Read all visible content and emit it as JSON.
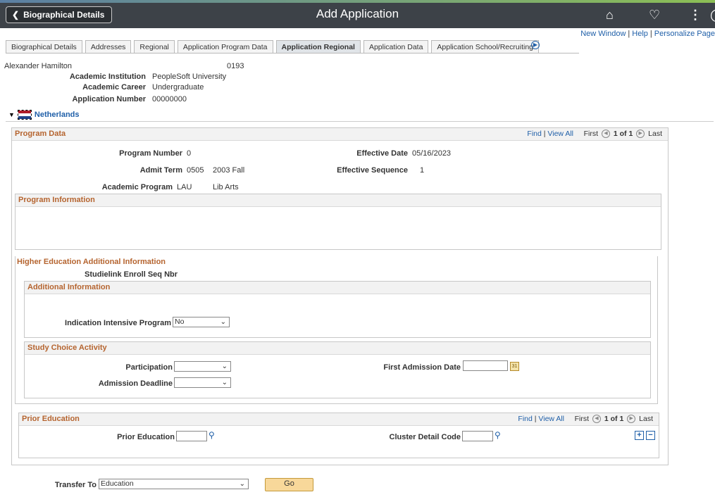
{
  "header": {
    "back_label": "Biographical Details",
    "title": "Add Application",
    "icons": [
      "home-icon",
      "bell-icon",
      "more-icon"
    ]
  },
  "links": {
    "new_window": "New Window",
    "help": "Help",
    "personalize": "Personalize Page"
  },
  "tabs": [
    {
      "label": "Biographical Details",
      "active": false
    },
    {
      "label": "Addresses",
      "active": false
    },
    {
      "label": "Regional",
      "active": false
    },
    {
      "label": "Application Program Data",
      "active": false
    },
    {
      "label": "Application Regional",
      "active": true
    },
    {
      "label": "Application Data",
      "active": false
    },
    {
      "label": "Application School/Recruiting",
      "active": false
    }
  ],
  "person": {
    "name": "Alexander Hamilton",
    "id": "0193",
    "institution_label": "Academic Institution",
    "institution": "PeopleSoft University",
    "career_label": "Academic Career",
    "career": "Undergraduate",
    "appnum_label": "Application Number",
    "appnum": "00000000"
  },
  "country": {
    "name": "Netherlands",
    "flag_colors": [
      "#ae1c28",
      "#ffffff",
      "#21468b"
    ]
  },
  "program_data": {
    "title": "Program Data",
    "nav": {
      "find": "Find",
      "view_all": "View All",
      "first": "First",
      "count": "1 of 1",
      "last": "Last"
    },
    "program_number_label": "Program Number",
    "program_number": "0",
    "effective_date_label": "Effective Date",
    "effective_date": "05/16/2023",
    "admit_term_label": "Admit Term",
    "admit_term": "0505",
    "admit_term_desc": "2003 Fall",
    "effective_sequence_label": "Effective Sequence",
    "effective_sequence": "1",
    "academic_program_label": "Academic Program",
    "academic_program": "LAU",
    "academic_program_desc": "Lib Arts"
  },
  "program_information": {
    "title": "Program Information"
  },
  "higher_ed": {
    "title": "Higher Education Additional Information",
    "studielink_label": "Studielink Enroll Seq Nbr",
    "additional_title": "Additional Information",
    "intensive_label": "Indication Intensive Program",
    "intensive_value": "No",
    "study_choice_title": "Study Choice Activity",
    "participation_label": "Participation",
    "participation_value": "",
    "first_admission_label": "First Admission Date",
    "first_admission_value": "",
    "admission_deadline_label": "Admission Deadline",
    "admission_deadline_value": ""
  },
  "prior_education": {
    "title": "Prior Education",
    "nav": {
      "find": "Find",
      "view_all": "View All",
      "first": "First",
      "count": "1 of 1",
      "last": "Last"
    },
    "prior_label": "Prior Education",
    "cluster_label": "Cluster Detail Code"
  },
  "transfer": {
    "label": "Transfer To",
    "value": "Education",
    "go": "Go"
  },
  "colors": {
    "header_bg": "#3d4248",
    "section_title": "#b5642f",
    "link": "#1f5fa8",
    "go_button": "#f8d89a"
  }
}
